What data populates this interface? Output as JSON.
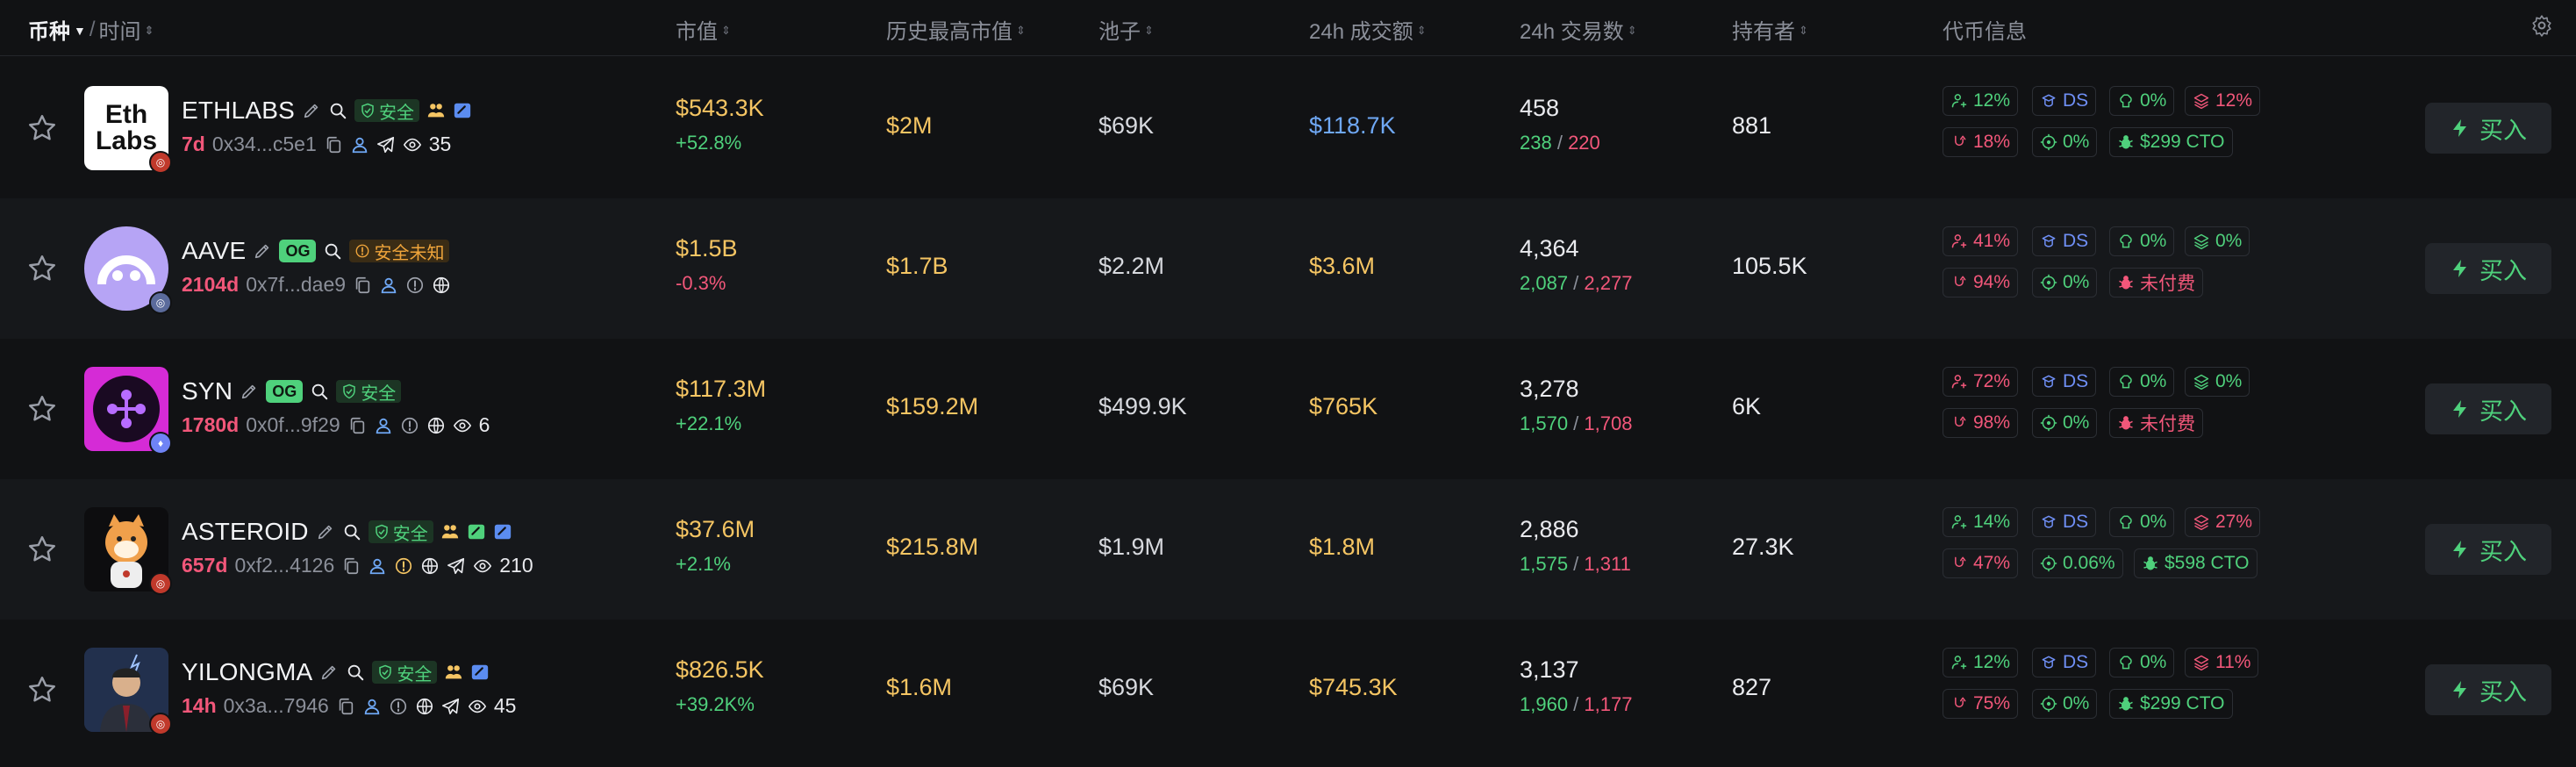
{
  "header": {
    "coin_label": "币种",
    "time_label": "时间",
    "mcap_label": "市值",
    "ath_label": "历史最高市值",
    "pool_label": "池子",
    "volume_label": "24h 成交额",
    "txns_label": "24h 交易数",
    "holders_label": "持有者",
    "info_label": "代币信息"
  },
  "colors": {
    "green": "#4fd17c",
    "red": "#f2577a",
    "yellow": "#f5c563",
    "blue": "#6fa8f5",
    "background": "#111214"
  },
  "rows": [
    {
      "symbol": "ETHLABS",
      "logo_text_1": "Eth",
      "logo_text_2": "Labs",
      "tag": "安全",
      "age": "7d",
      "address": "0x34...c5e1",
      "views": "35",
      "mcap": "$543.3K",
      "mcap_change": "+52.8%",
      "ath": "$2M",
      "pool": "$69K",
      "volume": "$118.7K",
      "txns": "458",
      "buys": "238",
      "sells": "220",
      "holders": "881",
      "info": {
        "h1": "12%",
        "ds": "DS",
        "h2": "0%",
        "h3": "12%",
        "h4": "18%",
        "h5": "0%",
        "h6": "$299 CTO"
      },
      "buy_label": "买入"
    },
    {
      "symbol": "AAVE",
      "og": "OG",
      "tag": "安全未知",
      "age": "2104d",
      "address": "0x7f...dae9",
      "mcap": "$1.5B",
      "mcap_change": "-0.3%",
      "ath": "$1.7B",
      "pool": "$2.2M",
      "volume": "$3.6M",
      "txns": "4,364",
      "buys": "2,087",
      "sells": "2,277",
      "holders": "105.5K",
      "info": {
        "h1": "41%",
        "ds": "DS",
        "h2": "0%",
        "h3": "0%",
        "h4": "94%",
        "h5": "0%",
        "h6": "未付费"
      },
      "buy_label": "买入"
    },
    {
      "symbol": "SYN",
      "og": "OG",
      "tag": "安全",
      "age": "1780d",
      "address": "0x0f...9f29",
      "views": "6",
      "mcap": "$117.3M",
      "mcap_change": "+22.1%",
      "ath": "$159.2M",
      "pool": "$499.9K",
      "volume": "$765K",
      "txns": "3,278",
      "buys": "1,570",
      "sells": "1,708",
      "holders": "6K",
      "info": {
        "h1": "72%",
        "ds": "DS",
        "h2": "0%",
        "h3": "0%",
        "h4": "98%",
        "h5": "0%",
        "h6": "未付费"
      },
      "buy_label": "买入"
    },
    {
      "symbol": "ASTEROID",
      "tag": "安全",
      "age": "657d",
      "address": "0xf2...4126",
      "views": "210",
      "mcap": "$37.6M",
      "mcap_change": "+2.1%",
      "ath": "$215.8M",
      "pool": "$1.9M",
      "volume": "$1.8M",
      "txns": "2,886",
      "buys": "1,575",
      "sells": "1,311",
      "holders": "27.3K",
      "info": {
        "h1": "14%",
        "ds": "DS",
        "h2": "0%",
        "h3": "27%",
        "h4": "47%",
        "h5": "0.06%",
        "h6": "$598 CTO"
      },
      "buy_label": "买入"
    },
    {
      "symbol": "YILONGMA",
      "tag": "安全",
      "age": "14h",
      "address": "0x3a...7946",
      "views": "45",
      "mcap": "$826.5K",
      "mcap_change": "+39.2K%",
      "ath": "$1.6M",
      "pool": "$69K",
      "volume": "$745.3K",
      "txns": "3,137",
      "buys": "1,960",
      "sells": "1,177",
      "holders": "827",
      "info": {
        "h1": "12%",
        "ds": "DS",
        "h2": "0%",
        "h3": "11%",
        "h4": "75%",
        "h5": "0%",
        "h6": "$299 CTO"
      },
      "buy_label": "买入"
    }
  ]
}
